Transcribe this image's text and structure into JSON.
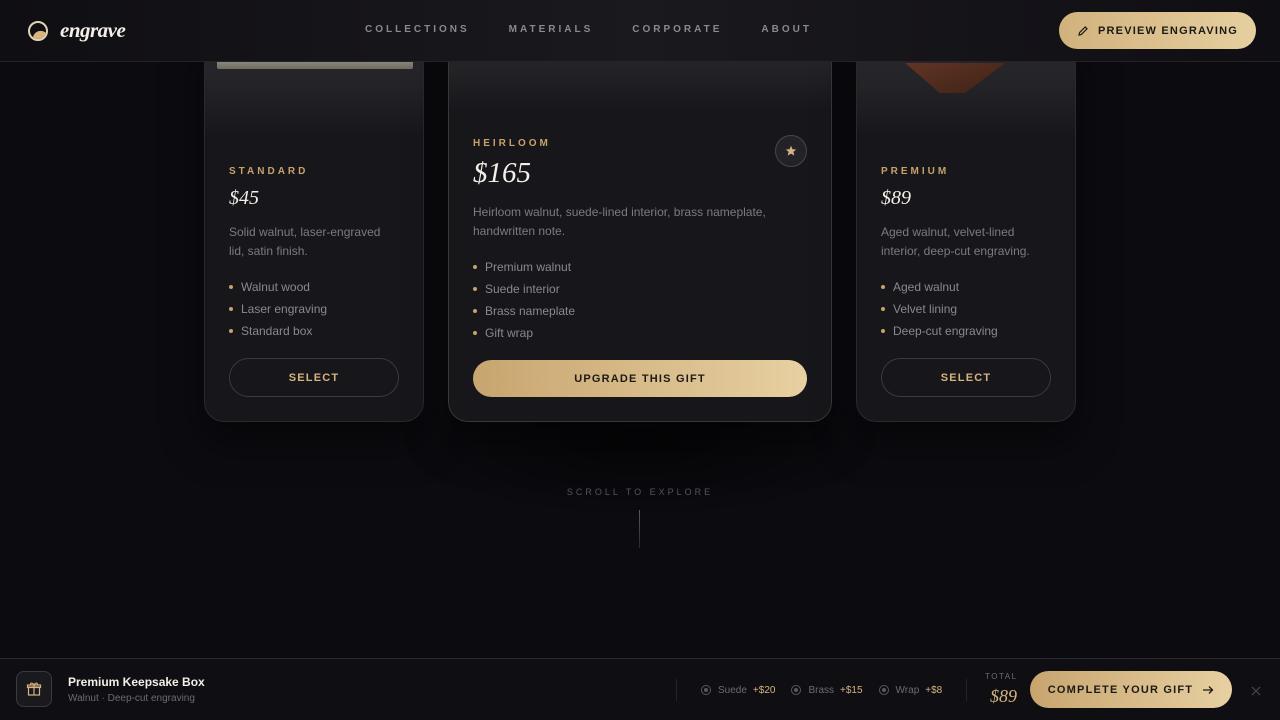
{
  "brand": {
    "name": "engrave",
    "logo_icon": "engrave-logo-icon"
  },
  "nav": {
    "items": [
      "COLLECTIONS",
      "MATERIALS",
      "CORPORATE",
      "ABOUT"
    ]
  },
  "header": {
    "preview_label": "PREVIEW ENGRAVING",
    "preview_icon": "pencil-icon"
  },
  "cards": {
    "standard": {
      "tier": "STANDARD",
      "price": "$45",
      "description": "Solid walnut, laser-engraved lid, satin finish.",
      "features": [
        "Walnut wood",
        "Laser engraving",
        "Standard box"
      ],
      "button": "SELECT"
    },
    "heirloom": {
      "tier": "HEIRLOOM",
      "price": "$165",
      "description": "Heirloom walnut, suede-lined interior, brass nameplate, handwritten note.",
      "features": [
        "Premium walnut",
        "Suede interior",
        "Brass nameplate",
        "Gift wrap"
      ],
      "button": "UPGRADE THIS GIFT",
      "badge_icon": "star-icon"
    },
    "premium": {
      "tier": "PREMIUM",
      "price": "$89",
      "description": "Aged walnut, velvet-lined interior, deep-cut engraving.",
      "features": [
        "Aged walnut",
        "Velvet lining",
        "Deep-cut engraving"
      ],
      "button": "SELECT"
    }
  },
  "scroll_cue": "SCROLL TO EXPLORE",
  "bottom_bar": {
    "product_name": "Premium Keepsake Box",
    "product_sub": "Walnut · Deep-cut engraving",
    "addons": [
      {
        "name": "Suede",
        "price": "+$20"
      },
      {
        "name": "Brass",
        "price": "+$15"
      },
      {
        "name": "Wrap",
        "price": "+$8"
      }
    ],
    "total_label": "TOTAL",
    "total_value": "$89",
    "complete_label": "COMPLETE YOUR GIFT",
    "close_icon": "close-icon"
  },
  "colors": {
    "accent": "#d4b47e",
    "background": "#0c0b10",
    "card": "#17161b"
  }
}
